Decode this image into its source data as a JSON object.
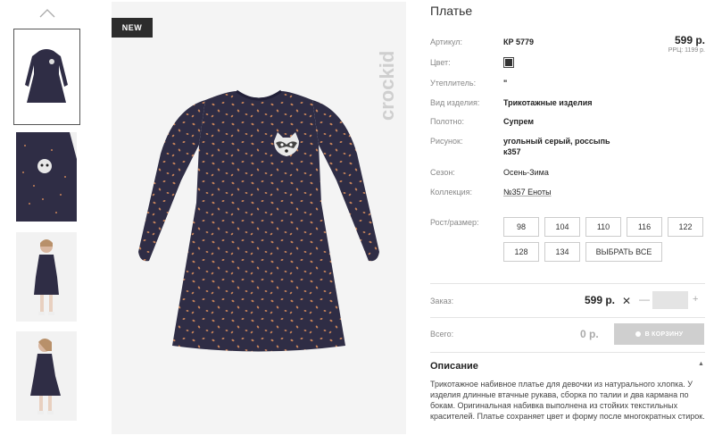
{
  "badge": "NEW",
  "brand": "crockid",
  "product": {
    "title": "Платье",
    "price": "599 р.",
    "rrc": "РРЦ: 1199 р.",
    "attributes": [
      {
        "label": "Артикул:",
        "value": "КР 5779"
      },
      {
        "label": "Цвет:",
        "value": ""
      },
      {
        "label": "Утеплитель:",
        "value": "\""
      },
      {
        "label": "Вид изделия:",
        "value": "Трикотажные изделия"
      },
      {
        "label": "Полотно:",
        "value": "Супрем"
      },
      {
        "label": "Рисунок:",
        "value_line1": "угольный серый, россыпь",
        "value_line2": "к357"
      },
      {
        "label": "Сезон:",
        "value": "Осень-Зима"
      },
      {
        "label": "Коллекция:",
        "value": "№357 Еноты"
      }
    ],
    "color_swatch": "#333333"
  },
  "sizes": {
    "label": "Рост/размер:",
    "items": [
      "98",
      "104",
      "110",
      "116",
      "122",
      "128",
      "134"
    ],
    "select_all": "ВЫБРАТЬ ВСЕ"
  },
  "order": {
    "label": "Заказ:",
    "price": "599 р.",
    "x_symbol": "✕",
    "minus": "—",
    "plus": "+",
    "qty": ""
  },
  "total": {
    "label": "Всего:",
    "value": "0 р.",
    "cart_button": "В КОРЗИНУ"
  },
  "description": {
    "title": "Описание",
    "toggle": "▲",
    "text": "Трикотажное набивное платье для девочки из натурального хлопка. У изделия длинные втачные рукава, сборка по талии и два кармана по бокам. Оригинальная набивка выполнена из стойких текстильных красителей. Платье сохраняет цвет и форму после многократных стирок."
  },
  "colors": {
    "dress": "#2f2d45",
    "dots": "#c8845a",
    "accent_dark": "#2c2c2c"
  }
}
